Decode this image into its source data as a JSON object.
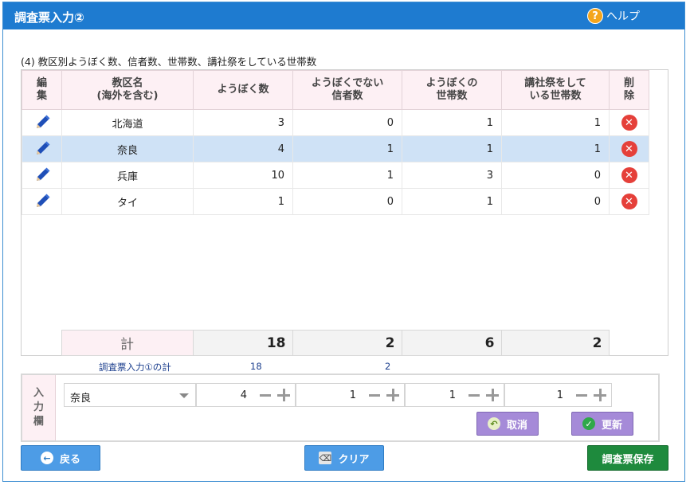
{
  "window": {
    "title": "調査票入力②",
    "help_label": "ヘルプ"
  },
  "section_title": "(4) 教区別ようぼく数、信者数、世帯数、講社祭をしている世帯数",
  "table": {
    "headers": {
      "edit": "編\n集",
      "district": "教区名\n(海外を含む)",
      "yobok": "ようぼく数",
      "believers": "ようぼくでない\n信者数",
      "households": "ようぼくの\n世帯数",
      "kosha": "講社祭をして\nいる世帯数",
      "delete": "削\n除"
    },
    "rows": [
      {
        "district": "北海道",
        "yobok": "3",
        "believers": "0",
        "households": "1",
        "kosha": "1"
      },
      {
        "district": "奈良",
        "yobok": "4",
        "believers": "1",
        "households": "1",
        "kosha": "1"
      },
      {
        "district": "兵庫",
        "yobok": "10",
        "believers": "1",
        "households": "3",
        "kosha": "0"
      },
      {
        "district": "タイ",
        "yobok": "1",
        "believers": "0",
        "households": "1",
        "kosha": "0"
      }
    ],
    "selected_row": 1,
    "total": {
      "label": "計",
      "yobok": "18",
      "believers": "2",
      "households": "6",
      "kosha": "2"
    }
  },
  "subtotal": {
    "label": "調査票入力①の計",
    "yobok": "18",
    "believers": "2"
  },
  "input_area": {
    "label": "入\n力\n欄",
    "district": "奈良",
    "yobok": "4",
    "believers": "1",
    "households": "1",
    "kosha": "1",
    "cancel_label": "取消",
    "update_label": "更新"
  },
  "footer": {
    "back_label": "戻る",
    "clear_label": "クリア",
    "save_label": "調査票保存"
  },
  "colors": {
    "header_blue": "#1e7bd0",
    "button_blue": "#4d9ce6",
    "button_purple": "#a58ad8",
    "save_green": "#1e8a3d",
    "delete_red": "#e5403a",
    "selected_row": "#cfe2f6"
  }
}
